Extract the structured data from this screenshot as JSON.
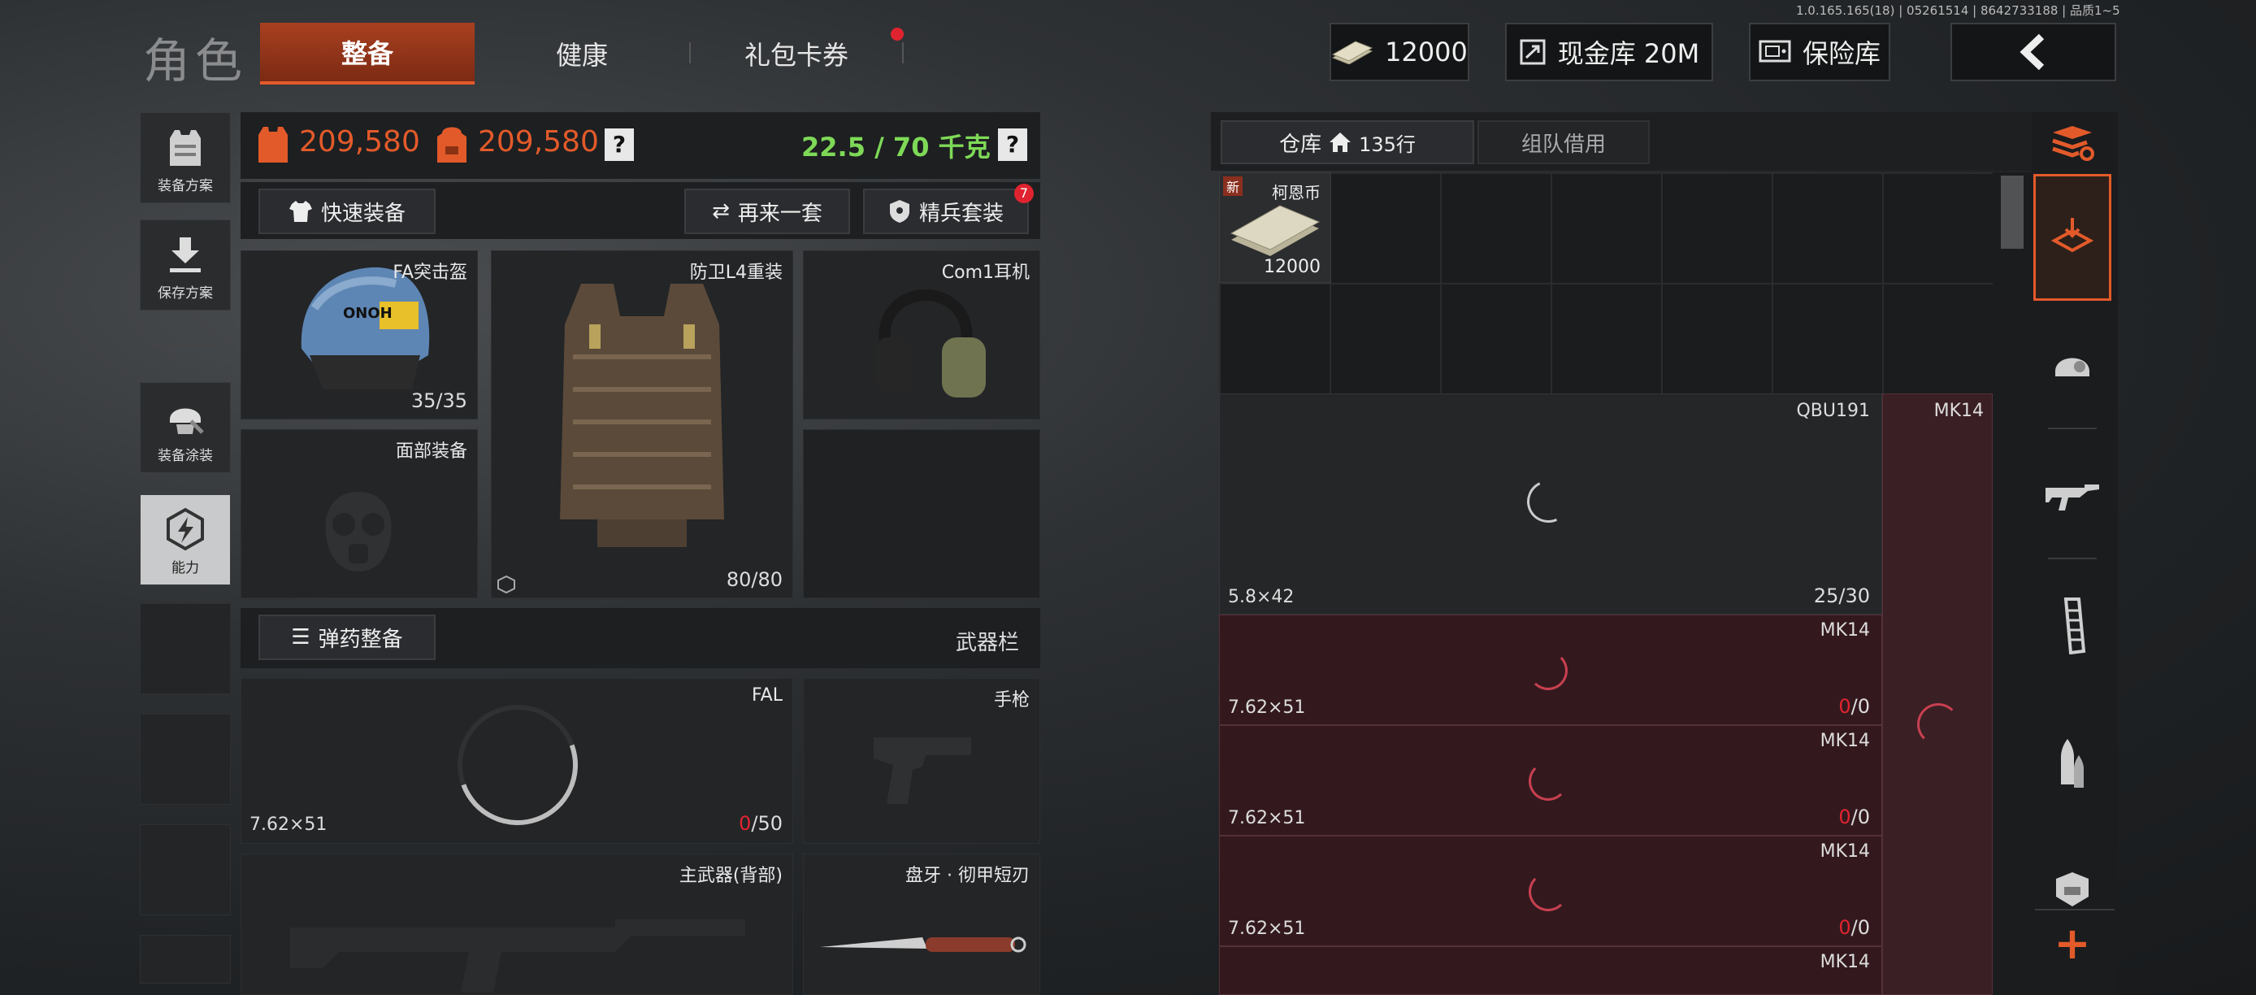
{
  "header": {
    "title": "角色",
    "tabs": [
      {
        "label": "整备"
      },
      {
        "label": "健康"
      },
      {
        "label": "礼包卡券"
      }
    ],
    "build_info": "1.0.165.165(18) | 05261514 | 8642733188 | 品质1~5",
    "currency": "12000",
    "cash_vault": "现金库 20M",
    "safe": "保险库",
    "back_icon": "chevron-left-icon"
  },
  "sidebar": {
    "items": [
      {
        "label": "装备方案",
        "icon": "vest-icon"
      },
      {
        "label": "保存方案",
        "icon": "download-icon"
      },
      {
        "label": "装备涂装",
        "icon": "helmet-paint-icon"
      },
      {
        "label": "能力",
        "icon": "lightning-icon"
      }
    ]
  },
  "loadout": {
    "value1": "209,580",
    "value2": "209,580",
    "help": "?",
    "weight": "22.5 / 70 千克",
    "quick_equip": "快速装备",
    "again": "再来一套",
    "elite": "精兵套装",
    "elite_badge": "7",
    "slots": {
      "helmet": {
        "label": "FA突击盔",
        "count": "35/35",
        "tag": "ONOH"
      },
      "armor": {
        "label": "防卫L4重装",
        "count": "80/80"
      },
      "headset": {
        "label": "Com1耳机"
      },
      "face": {
        "label": "面部装备"
      }
    },
    "ammo_button": "弹药整备",
    "weapon_bar": "武器栏",
    "weapons": {
      "fal": {
        "name": "FAL",
        "caliber": "7.62×51",
        "ammo_current": "0",
        "ammo_total": "/50"
      },
      "pistol": {
        "name": "手枪"
      },
      "main_back": {
        "name": "主武器(背部)"
      },
      "knife": {
        "name": "盘牙 · 彻甲短刃"
      }
    }
  },
  "warehouse": {
    "tab_label": "仓库",
    "rows": "135行",
    "team_tab": "组队借用",
    "coin": {
      "new_badge": "新",
      "name": "柯恩币",
      "count": "12000"
    },
    "qbu": {
      "name": "QBU191",
      "caliber": "5.8×42",
      "count": "25/30"
    },
    "mk_side": {
      "name": "MK14"
    },
    "mags": [
      {
        "name": "MK14",
        "caliber": "7.62×51",
        "current": "0",
        "total": "/0"
      },
      {
        "name": "MK14",
        "caliber": "7.62×51",
        "current": "0",
        "total": "/0"
      },
      {
        "name": "MK14",
        "caliber": "7.62×51",
        "current": "0",
        "total": "/0"
      },
      {
        "name": "MK14"
      }
    ]
  },
  "right_tools": {
    "items": [
      "sort-icon",
      "import-icon",
      "helmet-icon",
      "rifle-icon",
      "magazine-icon",
      "ammo-icon",
      "armor-plate-icon"
    ],
    "add": "+"
  },
  "colors": {
    "accent": "#e35a2a",
    "ammo_empty": "#e0242f",
    "weight": "#7ed957"
  }
}
